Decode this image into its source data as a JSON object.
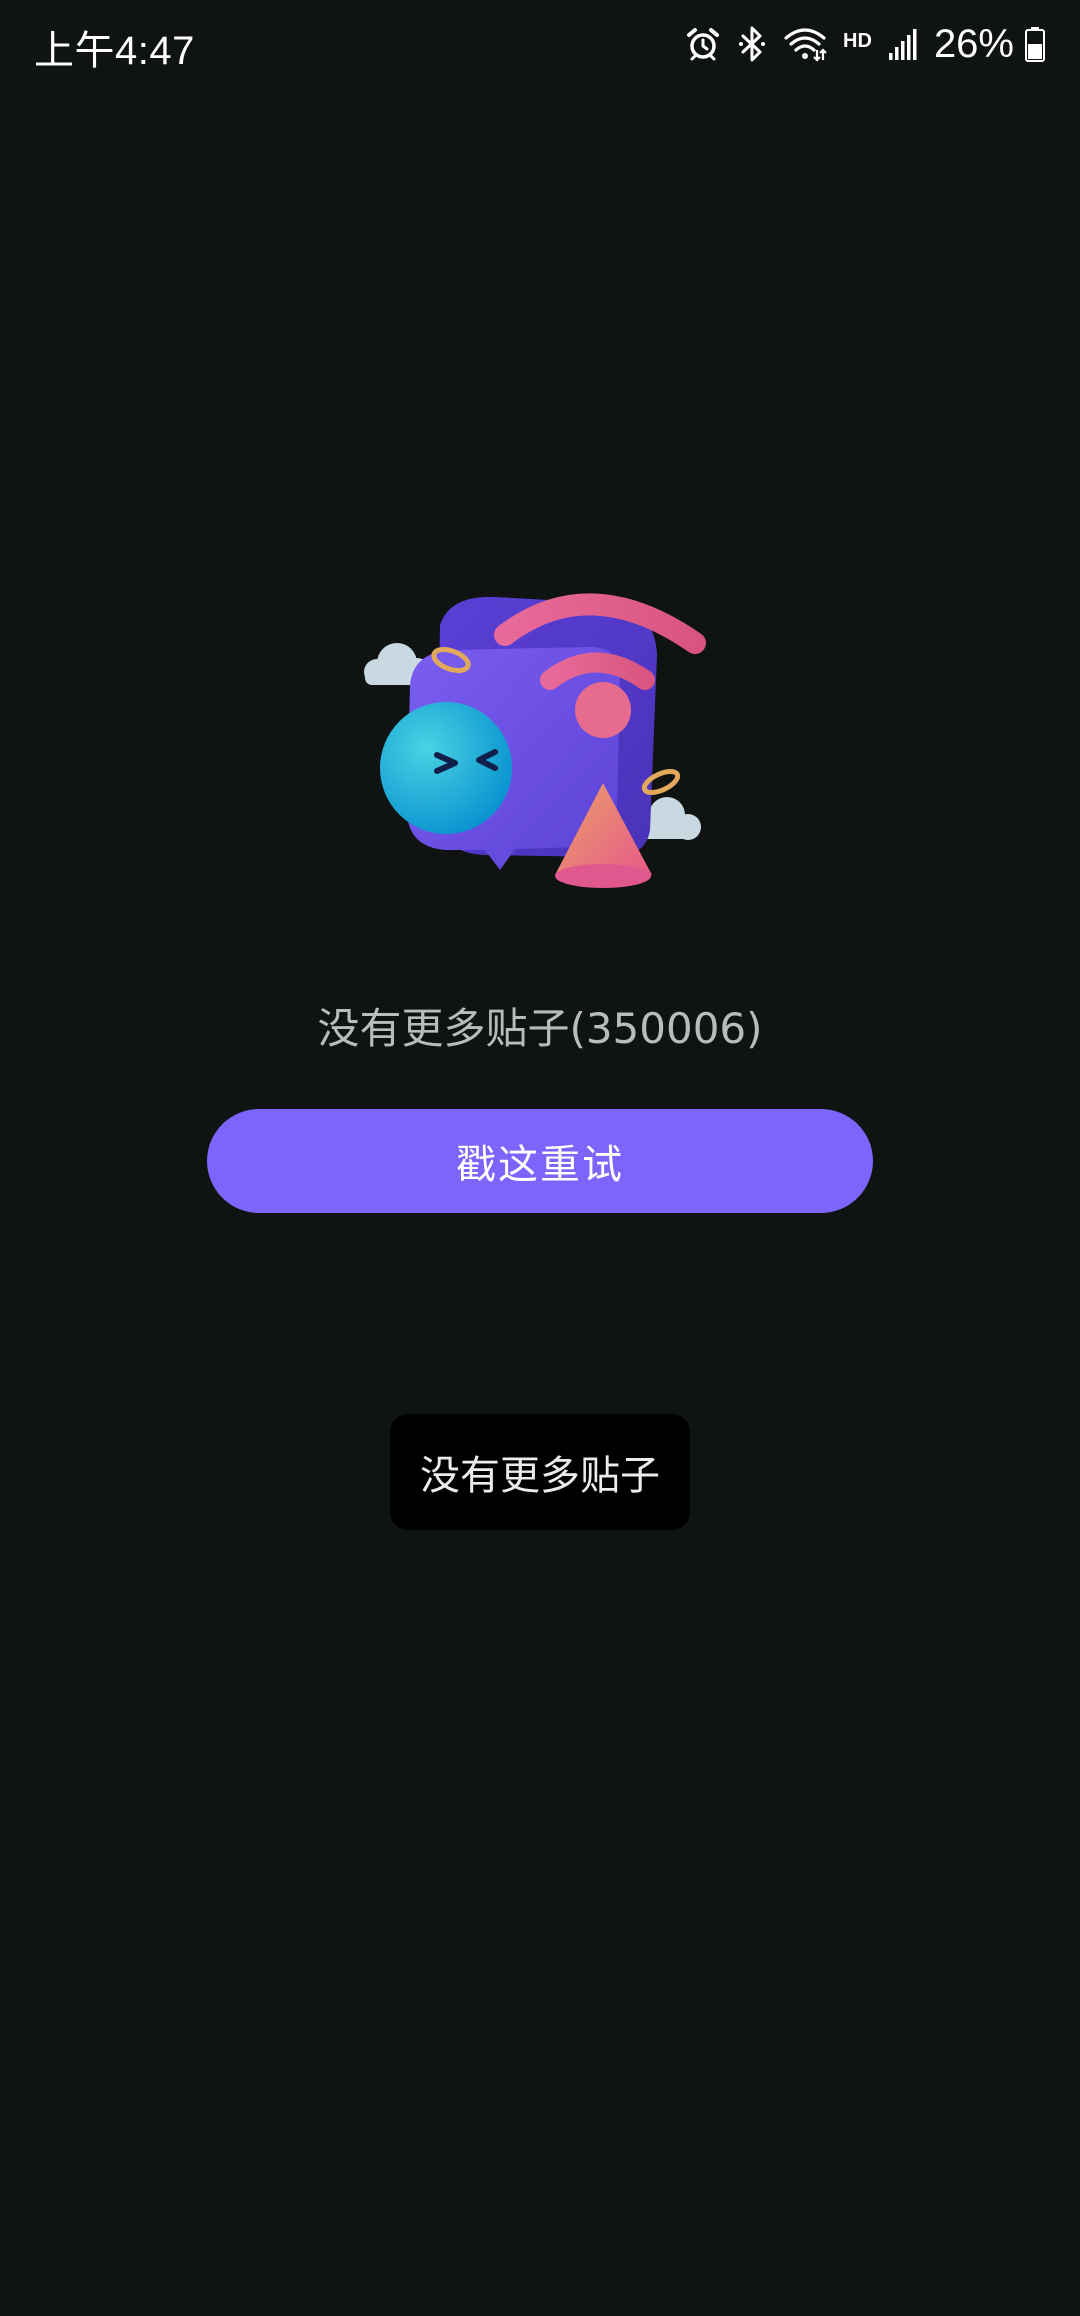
{
  "status_bar": {
    "time": "上午4:47",
    "hd_label": "HD",
    "battery_percent": "26%",
    "battery_level": 0.26,
    "icons": [
      "alarm-icon",
      "bluetooth-icon",
      "wifi-icon",
      "signal-icon",
      "battery-icon"
    ]
  },
  "empty_state": {
    "illustration": "no-network-illustration",
    "message": "没有更多贴子(350006)",
    "retry_label": "戳这重试"
  },
  "toast": {
    "text": "没有更多贴子"
  },
  "colors": {
    "background": "#0f1311",
    "accent": "#7d64fb",
    "message_text": "#b9bbbc",
    "toast_background": "#000000"
  }
}
